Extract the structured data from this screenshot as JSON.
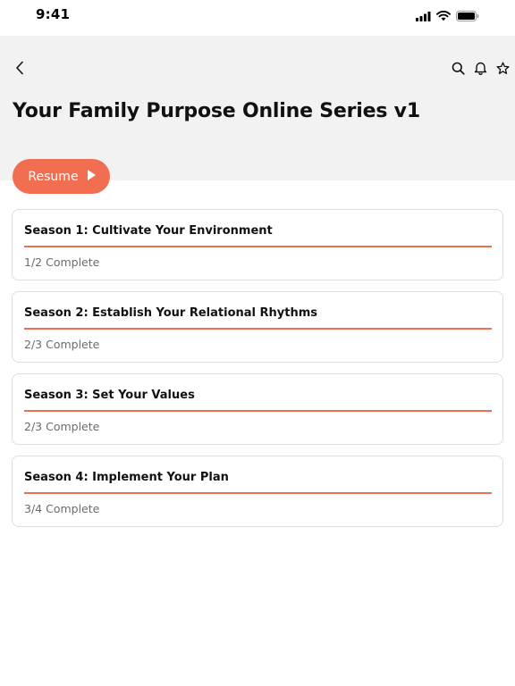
{
  "status_bar": {
    "time": "9:41",
    "icons": [
      "signal-icon",
      "wifi-icon",
      "battery-icon"
    ]
  },
  "nav": {
    "back_icon": "chevron-left-icon",
    "actions": [
      "search-icon",
      "bell-icon",
      "star-icon"
    ]
  },
  "page": {
    "title": "Your Family Purpose Online Series v1"
  },
  "resume_button": {
    "label": "Resume",
    "icon": "play-icon"
  },
  "seasons": [
    {
      "title": "Season 1: Cultivate Your Environment",
      "status": "1/2 Complete",
      "progress": 1.0
    },
    {
      "title": "Season 2: Establish Your Relational Rhythms",
      "status": "2/3 Complete",
      "progress": 1.0
    },
    {
      "title": "Season 3: Set Your Values",
      "status": "2/3 Complete",
      "progress": 1.0
    },
    {
      "title": "Season 4: Implement Your Plan",
      "status": "3/4 Complete",
      "progress": 1.0
    }
  ],
  "colors": {
    "accent": "#f26e50",
    "header_bg": "#f2f2f2",
    "card_border": "#dedede",
    "muted_text": "#6b6b6b"
  }
}
